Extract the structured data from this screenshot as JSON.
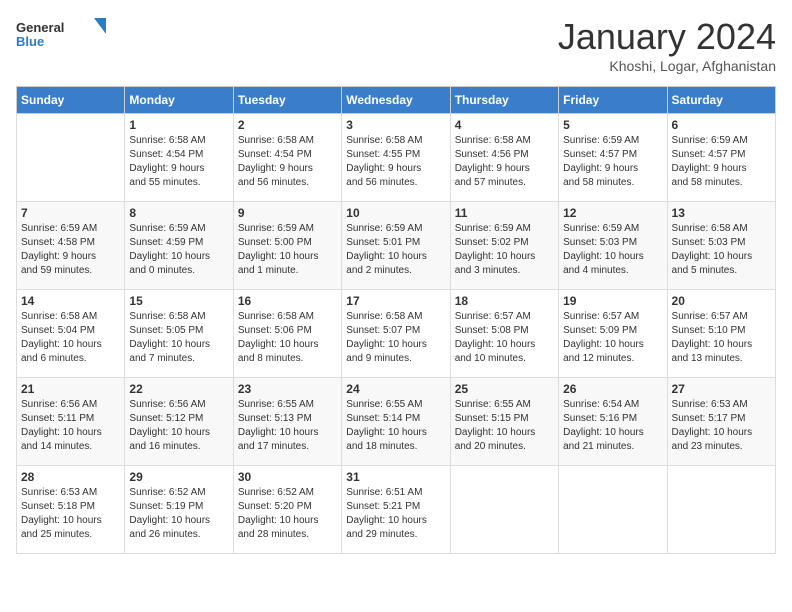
{
  "logo": {
    "general": "General",
    "blue": "Blue"
  },
  "title": "January 2024",
  "location": "Khoshi, Logar, Afghanistan",
  "days_of_week": [
    "Sunday",
    "Monday",
    "Tuesday",
    "Wednesday",
    "Thursday",
    "Friday",
    "Saturday"
  ],
  "weeks": [
    [
      {
        "day": "",
        "info": ""
      },
      {
        "day": "1",
        "info": "Sunrise: 6:58 AM\nSunset: 4:54 PM\nDaylight: 9 hours\nand 55 minutes."
      },
      {
        "day": "2",
        "info": "Sunrise: 6:58 AM\nSunset: 4:54 PM\nDaylight: 9 hours\nand 56 minutes."
      },
      {
        "day": "3",
        "info": "Sunrise: 6:58 AM\nSunset: 4:55 PM\nDaylight: 9 hours\nand 56 minutes."
      },
      {
        "day": "4",
        "info": "Sunrise: 6:58 AM\nSunset: 4:56 PM\nDaylight: 9 hours\nand 57 minutes."
      },
      {
        "day": "5",
        "info": "Sunrise: 6:59 AM\nSunset: 4:57 PM\nDaylight: 9 hours\nand 58 minutes."
      },
      {
        "day": "6",
        "info": "Sunrise: 6:59 AM\nSunset: 4:57 PM\nDaylight: 9 hours\nand 58 minutes."
      }
    ],
    [
      {
        "day": "7",
        "info": "Sunrise: 6:59 AM\nSunset: 4:58 PM\nDaylight: 9 hours\nand 59 minutes."
      },
      {
        "day": "8",
        "info": "Sunrise: 6:59 AM\nSunset: 4:59 PM\nDaylight: 10 hours\nand 0 minutes."
      },
      {
        "day": "9",
        "info": "Sunrise: 6:59 AM\nSunset: 5:00 PM\nDaylight: 10 hours\nand 1 minute."
      },
      {
        "day": "10",
        "info": "Sunrise: 6:59 AM\nSunset: 5:01 PM\nDaylight: 10 hours\nand 2 minutes."
      },
      {
        "day": "11",
        "info": "Sunrise: 6:59 AM\nSunset: 5:02 PM\nDaylight: 10 hours\nand 3 minutes."
      },
      {
        "day": "12",
        "info": "Sunrise: 6:59 AM\nSunset: 5:03 PM\nDaylight: 10 hours\nand 4 minutes."
      },
      {
        "day": "13",
        "info": "Sunrise: 6:58 AM\nSunset: 5:03 PM\nDaylight: 10 hours\nand 5 minutes."
      }
    ],
    [
      {
        "day": "14",
        "info": "Sunrise: 6:58 AM\nSunset: 5:04 PM\nDaylight: 10 hours\nand 6 minutes."
      },
      {
        "day": "15",
        "info": "Sunrise: 6:58 AM\nSunset: 5:05 PM\nDaylight: 10 hours\nand 7 minutes."
      },
      {
        "day": "16",
        "info": "Sunrise: 6:58 AM\nSunset: 5:06 PM\nDaylight: 10 hours\nand 8 minutes."
      },
      {
        "day": "17",
        "info": "Sunrise: 6:58 AM\nSunset: 5:07 PM\nDaylight: 10 hours\nand 9 minutes."
      },
      {
        "day": "18",
        "info": "Sunrise: 6:57 AM\nSunset: 5:08 PM\nDaylight: 10 hours\nand 10 minutes."
      },
      {
        "day": "19",
        "info": "Sunrise: 6:57 AM\nSunset: 5:09 PM\nDaylight: 10 hours\nand 12 minutes."
      },
      {
        "day": "20",
        "info": "Sunrise: 6:57 AM\nSunset: 5:10 PM\nDaylight: 10 hours\nand 13 minutes."
      }
    ],
    [
      {
        "day": "21",
        "info": "Sunrise: 6:56 AM\nSunset: 5:11 PM\nDaylight: 10 hours\nand 14 minutes."
      },
      {
        "day": "22",
        "info": "Sunrise: 6:56 AM\nSunset: 5:12 PM\nDaylight: 10 hours\nand 16 minutes."
      },
      {
        "day": "23",
        "info": "Sunrise: 6:55 AM\nSunset: 5:13 PM\nDaylight: 10 hours\nand 17 minutes."
      },
      {
        "day": "24",
        "info": "Sunrise: 6:55 AM\nSunset: 5:14 PM\nDaylight: 10 hours\nand 18 minutes."
      },
      {
        "day": "25",
        "info": "Sunrise: 6:55 AM\nSunset: 5:15 PM\nDaylight: 10 hours\nand 20 minutes."
      },
      {
        "day": "26",
        "info": "Sunrise: 6:54 AM\nSunset: 5:16 PM\nDaylight: 10 hours\nand 21 minutes."
      },
      {
        "day": "27",
        "info": "Sunrise: 6:53 AM\nSunset: 5:17 PM\nDaylight: 10 hours\nand 23 minutes."
      }
    ],
    [
      {
        "day": "28",
        "info": "Sunrise: 6:53 AM\nSunset: 5:18 PM\nDaylight: 10 hours\nand 25 minutes."
      },
      {
        "day": "29",
        "info": "Sunrise: 6:52 AM\nSunset: 5:19 PM\nDaylight: 10 hours\nand 26 minutes."
      },
      {
        "day": "30",
        "info": "Sunrise: 6:52 AM\nSunset: 5:20 PM\nDaylight: 10 hours\nand 28 minutes."
      },
      {
        "day": "31",
        "info": "Sunrise: 6:51 AM\nSunset: 5:21 PM\nDaylight: 10 hours\nand 29 minutes."
      },
      {
        "day": "",
        "info": ""
      },
      {
        "day": "",
        "info": ""
      },
      {
        "day": "",
        "info": ""
      }
    ]
  ]
}
